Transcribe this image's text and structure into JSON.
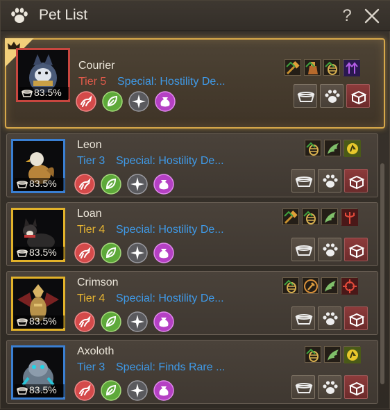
{
  "window": {
    "title": "Pet List",
    "help_label": "?"
  },
  "pets": [
    {
      "name": "Courier",
      "tier": "Tier 5",
      "special": "Special: Hostility De...",
      "hunger": "83.5%"
    },
    {
      "name": "Leon",
      "tier": "Tier 3",
      "special": "Special: Hostility De...",
      "hunger": "83.5%"
    },
    {
      "name": "Loan",
      "tier": "Tier 4",
      "special": "Special: Hostility De...",
      "hunger": "83.5%"
    },
    {
      "name": "Crimson",
      "tier": "Tier 4",
      "special": "Special: Hostility De...",
      "hunger": "83.5%"
    },
    {
      "name": "Axoloth",
      "tier": "Tier 3",
      "special": "Special: Finds Rare ...",
      "hunger": "83.5%"
    }
  ],
  "colors": {
    "accent_gold": "#d8a94a",
    "tier5": "#e05a4a",
    "tier4": "#e7b532",
    "tier3": "#3f9ae8"
  },
  "icons": {
    "title": "paw-icon",
    "close": "close-icon",
    "crown": "crown-icon",
    "actions": [
      "run-icon",
      "leaf-icon",
      "compass-icon",
      "pouch-icon"
    ],
    "commands": [
      "feed-bowl-icon",
      "paw-icon",
      "seal-box-icon"
    ]
  }
}
